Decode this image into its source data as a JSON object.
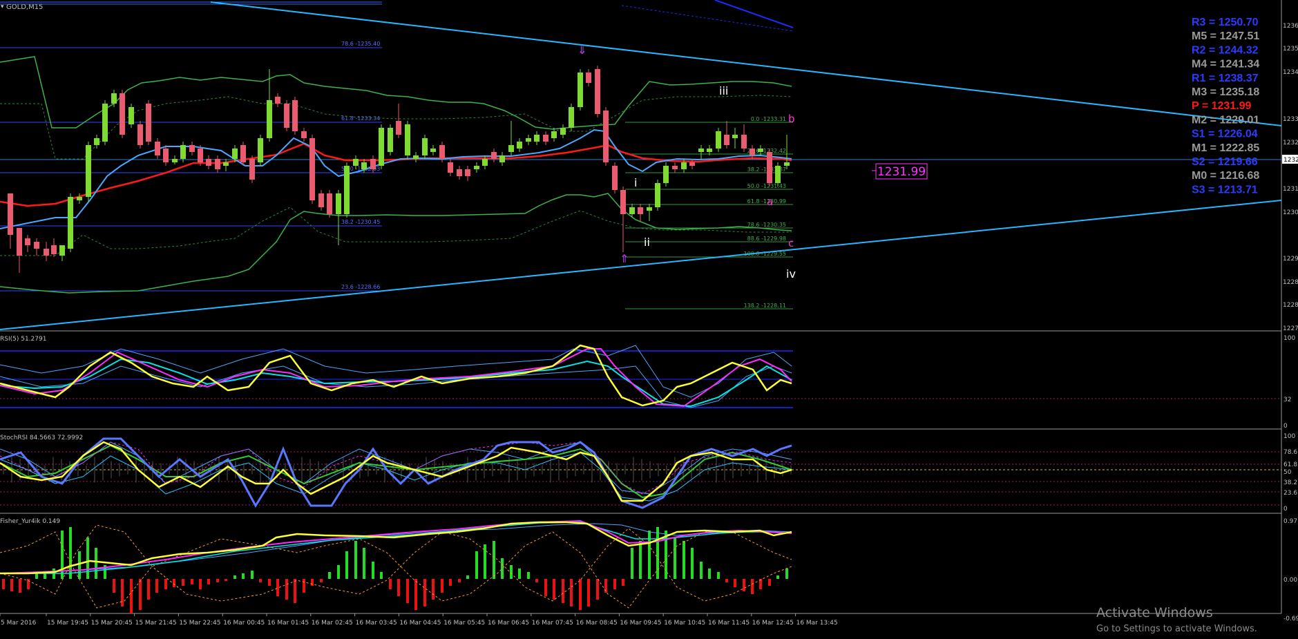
{
  "window": {
    "title": "GOLD,M15",
    "colors": {
      "bg": "#000000",
      "grid": "#303030",
      "up": "#7fdb32",
      "down": "#ea5b6f"
    }
  },
  "price_axis": {
    "labels": [
      "1236.",
      "1235.",
      "1234.",
      "1233.",
      "1232.",
      "1231.",
      "1230.",
      "1229.",
      "1228.",
      "1228.",
      "1227."
    ],
    "current": "1232."
  },
  "time_axis": {
    "labels": [
      "5 Mar 2016",
      "15 Mar 19:45",
      "15 Mar 20:45",
      "15 Mar 21:45",
      "15 Mar 22:45",
      "16 Mar 00:45",
      "16 Mar 01:45",
      "16 Mar 02:45",
      "16 Mar 03:45",
      "16 Mar 04:45",
      "16 Mar 05:45",
      "16 Mar 06:45",
      "16 Mar 07:45",
      "16 Mar 08:45",
      "16 Mar 09:45",
      "16 Mar 10:45",
      "16 Mar 11:45",
      "16 Mar 12:45",
      "16 Mar 13:45"
    ]
  },
  "pivots": [
    {
      "label": "R3 = 1250.70",
      "color": "#2b3cff"
    },
    {
      "label": "M5 = 1247.51",
      "color": "#9a9a9a"
    },
    {
      "label": "R2 = 1244.32",
      "color": "#2b3cff"
    },
    {
      "label": "M4 = 1241.34",
      "color": "#9a9a9a"
    },
    {
      "label": "R1 = 1238.37",
      "color": "#2b3cff"
    },
    {
      "label": "M3 = 1235.18",
      "color": "#9a9a9a"
    },
    {
      "label": "P  = 1231.99",
      "color": "#ff1a1a"
    },
    {
      "label": "M2 = 1229.01",
      "color": "#9a9a9a"
    },
    {
      "label": "S1 = 1226.04",
      "color": "#2b3cff"
    },
    {
      "label": "M1 = 1222.85",
      "color": "#9a9a9a"
    },
    {
      "label": "S2 = 1219.66",
      "color": "#2b3cff"
    },
    {
      "label": "M0 = 1216.68",
      "color": "#9a9a9a"
    },
    {
      "label": "S3 = 1213.71",
      "color": "#2b3cff"
    }
  ],
  "price_badge": "1231.99",
  "fib_left": [
    "78.6 -1235.40",
    "61.8 -1233.34",
    "50.0 -1232.03",
    "38.2 -1230.45",
    "23.6 -1228.66"
  ],
  "fib_right": [
    "0.0 -1233.31",
    "23.6 -1232.42",
    "38.2 -1231.87",
    "50.0 -1231.43",
    "61.8 -1230.99",
    "78.6 -1230.35",
    "88.6 -1229.98",
    "100.0 -1229.55",
    "138.2 -1228.11"
  ],
  "waves": {
    "i": "i",
    "ii": "ii",
    "iii": "iii",
    "iv": "iv",
    "a": "a",
    "b": "b",
    "c": "c"
  },
  "panels": {
    "rsi": {
      "title": "RSI(5) 51.2791",
      "scale": [
        "100",
        "32",
        "0"
      ]
    },
    "stoch": {
      "title": "StochRSI 84.5663 72.9992",
      "scale": [
        "100",
        "78.6",
        "61.8",
        "50",
        "38.2",
        "23.6",
        "0"
      ]
    },
    "fisher": {
      "title": "Fisher_Yur4ik 0.149",
      "scale": [
        "0.971",
        "0.00",
        "-0.694"
      ]
    }
  },
  "watermark": {
    "line1": "Activate Windows",
    "line2": "Go to Settings to activate Windows."
  }
}
